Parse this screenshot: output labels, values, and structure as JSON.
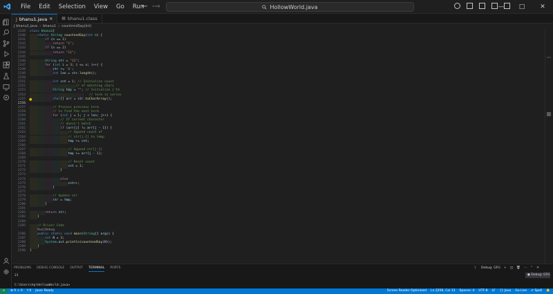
{
  "titlebar": {
    "menu": [
      "File",
      "Edit",
      "Selection",
      "View",
      "Go",
      "Run",
      "···"
    ],
    "search_text": "HollowWorld.java"
  },
  "tabs": [
    {
      "label": "bhanu1.java",
      "active": true
    },
    {
      "label": "bhanu1.class",
      "active": false
    }
  ],
  "breadcrumb": [
    "J bhanu1.java",
    "bhanu1",
    "countnndSay(int)"
  ],
  "editor": {
    "lines": [
      {
        "no": "2239",
        "html": "<span class='k'>class</span> <span class='t'>bhanu1</span><span class='p'>{</span>"
      },
      {
        "no": "2240",
        "html": "    <span class='k'>static</span> <span class='t'>String</span> <span class='f'>countnndSay</span><span class='p'>(</span><span class='k'>int</span> <span class='v'>n</span><span class='p'>) {</span>"
      },
      {
        "no": "2241",
        "html": "        <span class='kw2'>if</span> <span class='p'>(</span><span class='v'>n</span> <span class='p'>==</span> <span class='n'>1</span><span class='p'>)</span>"
      },
      {
        "no": "2242",
        "html": "            <span class='kw2'>return</span> <span class='s'>\"1\"</span><span class='p'>;</span>"
      },
      {
        "no": "2243",
        "html": "        <span class='kw2'>if</span> <span class='p'>(</span><span class='v'>n</span> <span class='p'>==</span> <span class='n'>2</span><span class='p'>)</span>"
      },
      {
        "no": "2244",
        "html": "            <span class='kw2'>return</span> <span class='s'>\"11\"</span><span class='p'>;</span>"
      },
      {
        "no": "2245",
        "html": ""
      },
      {
        "no": "2246",
        "html": "        <span class='t'>String</span> <span class='v'>str</span> <span class='p'>=</span> <span class='s'>\"11\"</span><span class='p'>;</span>"
      },
      {
        "no": "2247",
        "html": "        <span class='kw2'>for</span> <span class='p'>(</span><span class='k'>int</span> <span class='v'>i</span> <span class='p'>=</span> <span class='n'>3</span><span class='p'>;</span> <span class='v'>i</span> <span class='p'>&lt;=</span> <span class='v'>n</span><span class='p'>;</span> <span class='v'>i</span><span class='p'>++) {</span>"
      },
      {
        "no": "2248",
        "html": "            <span class='v'>str</span> <span class='p'>+=</span> <span class='s'>'$'</span><span class='p'>;</span>"
      },
      {
        "no": "2249",
        "html": "            <span class='k'>int</span> <span class='v'>len</span> <span class='p'>=</span> <span class='v'>str</span><span class='p'>.</span><span class='f'>length</span><span class='p'>();</span>"
      },
      {
        "no": "2250",
        "html": ""
      },
      {
        "no": "2251",
        "html": "            <span class='k'>int</span> <span class='v'>cnt</span> <span class='p'>=</span> <span class='n'>1</span><span class='p'>;</span> <span class='c'>// Initialize count</span>"
      },
      {
        "no": "2252",
        "html": "                        <span class='c'>// of matching chars</span>"
      },
      {
        "no": "2253",
        "html": "            <span class='t'>String</span> <span class='v'>tmp</span> <span class='p'>=</span> <span class='s'>\"\"</span><span class='p'>;</span> <span class='c'>// Initialize i'th</span>"
      },
      {
        "no": "2254",
        "html": "                               <span class='c'>// term in series</span>"
      },
      {
        "no": "2255",
        "html": "            <span class='k'>char</span><span class='p'>[]</span> <span class='v'>arr</span> <span class='p'>=</span> <span class='v'>str</span><span class='p'>.</span><span class='f'>toCharArray</span><span class='p'>();</span>"
      },
      {
        "no": "2256",
        "html": ""
      },
      {
        "no": "2257",
        "html": "            <span class='c'>// Process previous term</span>"
      },
      {
        "no": "2258",
        "html": "            <span class='c'>// to find the next term</span>"
      },
      {
        "no": "2259",
        "html": "            <span class='kw2'>for</span> <span class='p'>(</span><span class='k'>int</span> <span class='v'>j</span> <span class='p'>=</span> <span class='n'>1</span><span class='p'>;</span> <span class='v'>j</span> <span class='p'>&lt;</span> <span class='v'>len</span><span class='p'>;</span> <span class='v'>j</span><span class='p'>++) {</span>"
      },
      {
        "no": "2260",
        "html": "                <span class='c'>// If current character</span>"
      },
      {
        "no": "2261",
        "html": "                <span class='c'>// doesn't match</span>"
      },
      {
        "no": "2262",
        "html": "                <span class='kw2'>if</span> <span class='p'>(</span><span class='v'>arr</span><span class='p'>[</span><span class='v'>j</span><span class='p'>] !=</span> <span class='v'>arr</span><span class='p'>[</span><span class='v'>j</span> <span class='p'>-</span> <span class='n'>1</span><span class='p'>]) {</span>"
      },
      {
        "no": "2263",
        "html": "                    <span class='c'>// Append count of</span>"
      },
      {
        "no": "2264",
        "html": "                    <span class='c'>// str[j-1] to temp</span>"
      },
      {
        "no": "2265",
        "html": "                    <span class='v'>tmp</span> <span class='p'>+=</span> <span class='v'>cnt</span><span class='p'>;</span>"
      },
      {
        "no": "2266",
        "html": ""
      },
      {
        "no": "2267",
        "html": "                    <span class='c'>// Append str[j-1]</span>"
      },
      {
        "no": "2268",
        "html": "                    <span class='v'>tmp</span> <span class='p'>+=</span> <span class='v'>arr</span><span class='p'>[</span><span class='v'>j</span> <span class='p'>-</span> <span class='n'>1</span><span class='p'>];</span>"
      },
      {
        "no": "2269",
        "html": ""
      },
      {
        "no": "2270",
        "html": "                    <span class='c'>// Reset count</span>"
      },
      {
        "no": "2271",
        "html": "                    <span class='v'>cnt</span> <span class='p'>=</span> <span class='n'>1</span><span class='p'>;</span>"
      },
      {
        "no": "2272",
        "html": "                <span class='p'>}</span>"
      },
      {
        "no": "2273",
        "html": ""
      },
      {
        "no": "2274",
        "html": "                <span class='kw2'>else</span>"
      },
      {
        "no": "2275",
        "html": "                    <span class='v'>cnt</span><span class='p'>++;</span>"
      },
      {
        "no": "2276",
        "html": "            <span class='p'>}</span>"
      },
      {
        "no": "2277",
        "html": ""
      },
      {
        "no": "2278",
        "html": "            <span class='c'>// Update str</span>"
      },
      {
        "no": "2279",
        "html": "            <span class='v'>str</span> <span class='p'>=</span> <span class='v'>tmp</span><span class='p'>;</span>"
      },
      {
        "no": "2280",
        "html": "        <span class='p'>}</span>"
      },
      {
        "no": "2281",
        "html": ""
      },
      {
        "no": "2282",
        "html": "        <span class='kw2'>return</span> <span class='v'>str</span><span class='p'>;</span>"
      },
      {
        "no": "2283",
        "html": "    <span class='p'>}</span>"
      },
      {
        "no": "2284",
        "html": ""
      },
      {
        "no": "2285",
        "html": "    <span class='c'>// Driver Code</span>"
      },
      {
        "no": "",
        "html": "    <span class='p' style='color:#9d9d9d'>Run|Debug</span>"
      },
      {
        "no": "2286",
        "html": "    <span class='k'>public</span> <span class='k'>static</span> <span class='k'>void</span> <span class='f'>main</span><span class='p'>(</span><span class='t'>String</span><span class='p'>[]</span> <span class='v'>args</span><span class='p'>) {</span>"
      },
      {
        "no": "2287",
        "html": "        <span class='k'>int</span> <span class='v'>N</span> <span class='p'>=</span> <span class='n'>3</span><span class='p'>;</span>"
      },
      {
        "no": "2288",
        "html": "        <span class='t'>System</span><span class='p'>.</span><span class='v'>out</span><span class='p'>.</span><span class='f'>println</span><span class='p'>(</span><span class='f'>countnndSay</span><span class='p'>(</span><span class='v'>N</span><span class='p'>));</span>"
      },
      {
        "no": "2289",
        "html": "    <span class='p'>}</span>"
      },
      {
        "no": "2290",
        "html": "<span class='p'>}</span>"
      }
    ],
    "current_line": "2256"
  },
  "panel": {
    "tabs": [
      "PROBLEMS",
      "DEBUG CONSOLE",
      "OUTPUT",
      "TERMINAL",
      "PORTS"
    ],
    "active_tab": "TERMINAL",
    "right_label": "Debug: GFG",
    "terminal_lines": [
      "21",
      "",
      "C:\\Users\\hp\\HellowWorld.java>"
    ],
    "terminal_list_item": "Debug: GFG"
  },
  "statusbar": {
    "left": [
      "⊗ 0 ⚠ 0",
      "⭡ 0",
      "Java: Ready"
    ],
    "right": [
      "Screen Reader Optimized",
      "Ln 2256, Col 13",
      "Spaces: 4",
      "UTF-8",
      "LF",
      "{} Java",
      "Go Live",
      "✔ Spell"
    ]
  },
  "colors": {
    "accent": "#0078d4",
    "statusbar": "#0078d4",
    "remote": "#16825d"
  }
}
